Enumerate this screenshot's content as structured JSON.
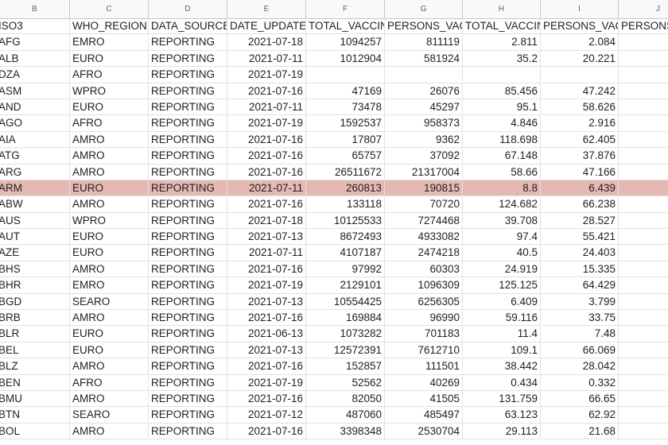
{
  "column_letters": [
    "B",
    "C",
    "D",
    "E",
    "F",
    "G",
    "H",
    "I",
    "J"
  ],
  "headers": [
    "ISO3",
    "WHO_REGION",
    "DATA_SOURCE",
    "DATE_UPDATED",
    "TOTAL_VACCINATIONS",
    "PERSONS_VACCINATED",
    "TOTAL_VACCINATIONS",
    "PERSONS_VACCINATED",
    "PERSONS_VAC"
  ],
  "rows": [
    [
      "AFG",
      "EMRO",
      "REPORTING",
      "2021-07-18",
      "1094257",
      "811119",
      "2.811",
      "2.084",
      "2"
    ],
    [
      "ALB",
      "EURO",
      "REPORTING",
      "2021-07-11",
      "1012904",
      "581924",
      "35.2",
      "20.221",
      "4"
    ],
    [
      "DZA",
      "AFRO",
      "REPORTING",
      "2021-07-19",
      "",
      "",
      "",
      "",
      ""
    ],
    [
      "ASM",
      "WPRO",
      "REPORTING",
      "2021-07-16",
      "47169",
      "26076",
      "85.456",
      "47.242",
      ""
    ],
    [
      "AND",
      "EURO",
      "REPORTING",
      "2021-07-11",
      "73478",
      "45297",
      "95.1",
      "58.626",
      ""
    ],
    [
      "AGO",
      "AFRO",
      "REPORTING",
      "2021-07-19",
      "1592537",
      "958373",
      "4.846",
      "2.916",
      "6"
    ],
    [
      "AIA",
      "AMRO",
      "REPORTING",
      "2021-07-16",
      "17807",
      "9362",
      "118.698",
      "62.405",
      ""
    ],
    [
      "ATG",
      "AMRO",
      "REPORTING",
      "2021-07-16",
      "65757",
      "37092",
      "67.148",
      "37.876",
      ""
    ],
    [
      "ARG",
      "AMRO",
      "REPORTING",
      "2021-07-16",
      "26511672",
      "21317004",
      "58.66",
      "47.166",
      "51"
    ],
    [
      "ARM",
      "EURO",
      "REPORTING",
      "2021-07-11",
      "260813",
      "190815",
      "8.8",
      "6.439",
      ""
    ],
    [
      "ABW",
      "AMRO",
      "REPORTING",
      "2021-07-16",
      "133118",
      "70720",
      "124.682",
      "66.238",
      ""
    ],
    [
      "AUS",
      "WPRO",
      "REPORTING",
      "2021-07-18",
      "10125533",
      "7274468",
      "39.708",
      "28.527",
      "28"
    ],
    [
      "AUT",
      "EURO",
      "REPORTING",
      "2021-07-13",
      "8672493",
      "4933082",
      "97.4",
      "55.421",
      "35"
    ],
    [
      "AZE",
      "EURO",
      "REPORTING",
      "2021-07-11",
      "4107187",
      "2474218",
      "40.5",
      "24.403",
      "16"
    ],
    [
      "BHS",
      "AMRO",
      "REPORTING",
      "2021-07-16",
      "97992",
      "60303",
      "24.919",
      "15.335",
      ""
    ],
    [
      "BHR",
      "EMRO",
      "REPORTING",
      "2021-07-19",
      "2129101",
      "1096309",
      "125.125",
      "64.429",
      "10"
    ],
    [
      "BGD",
      "SEARO",
      "REPORTING",
      "2021-07-13",
      "10554425",
      "6256305",
      "6.409",
      "3.799",
      "42"
    ],
    [
      "BRB",
      "AMRO",
      "REPORTING",
      "2021-07-16",
      "169884",
      "96990",
      "59.116",
      "33.75",
      ""
    ],
    [
      "BLR",
      "EURO",
      "REPORTING",
      "2021-06-13",
      "1073282",
      "701183",
      "11.4",
      "7.48",
      "3"
    ],
    [
      "BEL",
      "EURO",
      "REPORTING",
      "2021-07-13",
      "12572391",
      "7612710",
      "109.1",
      "66.069",
      "46"
    ],
    [
      "BLZ",
      "AMRO",
      "REPORTING",
      "2021-07-16",
      "152857",
      "111501",
      "38.442",
      "28.042",
      ""
    ],
    [
      "BEN",
      "AFRO",
      "REPORTING",
      "2021-07-19",
      "52562",
      "40269",
      "0.434",
      "0.332",
      ""
    ],
    [
      "BMU",
      "AMRO",
      "REPORTING",
      "2021-07-16",
      "82050",
      "41505",
      "131.759",
      "66.65",
      ""
    ],
    [
      "BTN",
      "SEARO",
      "REPORTING",
      "2021-07-12",
      "487060",
      "485497",
      "63.123",
      "62.92",
      ""
    ],
    [
      "BOL",
      "AMRO",
      "REPORTING",
      "2021-07-16",
      "3398348",
      "2530704",
      "29.113",
      "21.68",
      "8"
    ]
  ],
  "highlight_row_index": 9,
  "colors": {
    "highlight": "#e6b8b4",
    "header_bg": "#f8f9fa",
    "grid_line": "#e2e2e2"
  }
}
